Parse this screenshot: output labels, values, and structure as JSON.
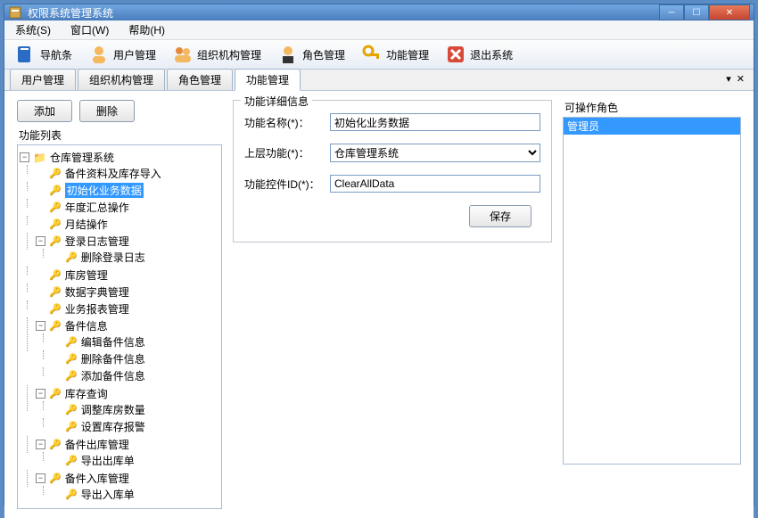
{
  "window": {
    "title": "权限系统管理系统"
  },
  "menu": {
    "system": "系统(S)",
    "window": "窗口(W)",
    "help": "帮助(H)"
  },
  "toolbar": {
    "nav": "导航条",
    "user": "用户管理",
    "org": "组织机构管理",
    "role": "角色管理",
    "func": "功能管理",
    "exit": "退出系统"
  },
  "tabs": {
    "user": "用户管理",
    "org": "组织机构管理",
    "role": "角色管理",
    "func": "功能管理"
  },
  "left": {
    "add": "添加",
    "delete": "删除",
    "list_label": "功能列表"
  },
  "tree": {
    "root": "仓库管理系统",
    "n1": "备件资料及库存导入",
    "n2": "初始化业务数据",
    "n3": "年度汇总操作",
    "n4": "月结操作",
    "n5": "登录日志管理",
    "n5a": "删除登录日志",
    "n6": "库房管理",
    "n7": "数据字典管理",
    "n8": "业务报表管理",
    "n9": "备件信息",
    "n9a": "编辑备件信息",
    "n9b": "删除备件信息",
    "n9c": "添加备件信息",
    "n10": "库存查询",
    "n10a": "调整库房数量",
    "n10b": "设置库存报警",
    "n11": "备件出库管理",
    "n11a": "导出出库单",
    "n12": "备件入库管理",
    "n12a": "导出入库单"
  },
  "form": {
    "group": "功能详细信息",
    "name_label": "功能名称(*)：",
    "name_value": "初始化业务数据",
    "parent_label": "上层功能(*)：",
    "parent_value": "仓库管理系统",
    "ctlid_label": "功能控件ID(*)：",
    "ctlid_value": "ClearAllData",
    "save": "保存"
  },
  "roles": {
    "label": "可操作角色",
    "item": "管理员"
  }
}
